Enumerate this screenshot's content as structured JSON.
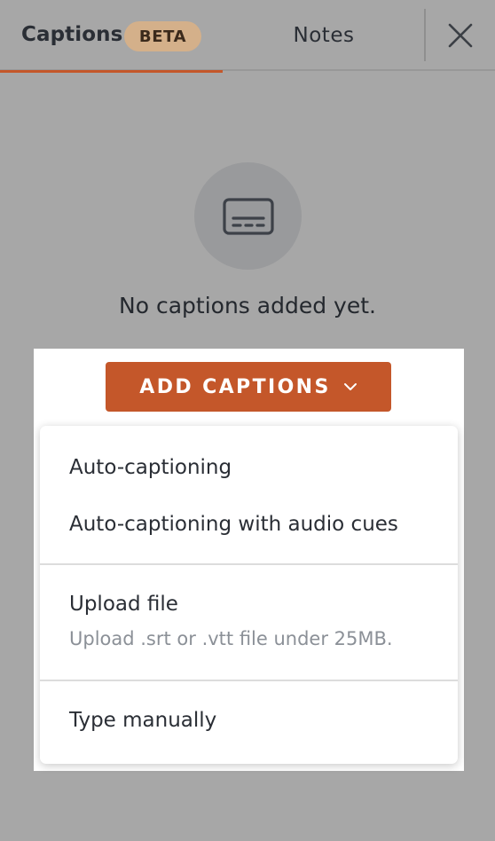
{
  "tabs": {
    "captions_label": "Captions",
    "beta_badge": "BETA",
    "notes_label": "Notes"
  },
  "icons": {
    "close": "close-icon",
    "captions": "closed-captions-icon",
    "chevron": "chevron-down-icon"
  },
  "empty_state": {
    "message": "No captions added yet."
  },
  "add_button": {
    "label": "ADD CAPTIONS"
  },
  "menu": {
    "auto_captioning": "Auto-captioning",
    "auto_captioning_audio_cues": "Auto-captioning with audio cues",
    "upload_file": "Upload file",
    "upload_file_hint": "Upload .srt or .vtt file under 25MB.",
    "type_manually": "Type manually"
  },
  "colors": {
    "accent": "#c4572a",
    "badge": "#d4b08a",
    "overlay_background": "#a7a7a7"
  }
}
